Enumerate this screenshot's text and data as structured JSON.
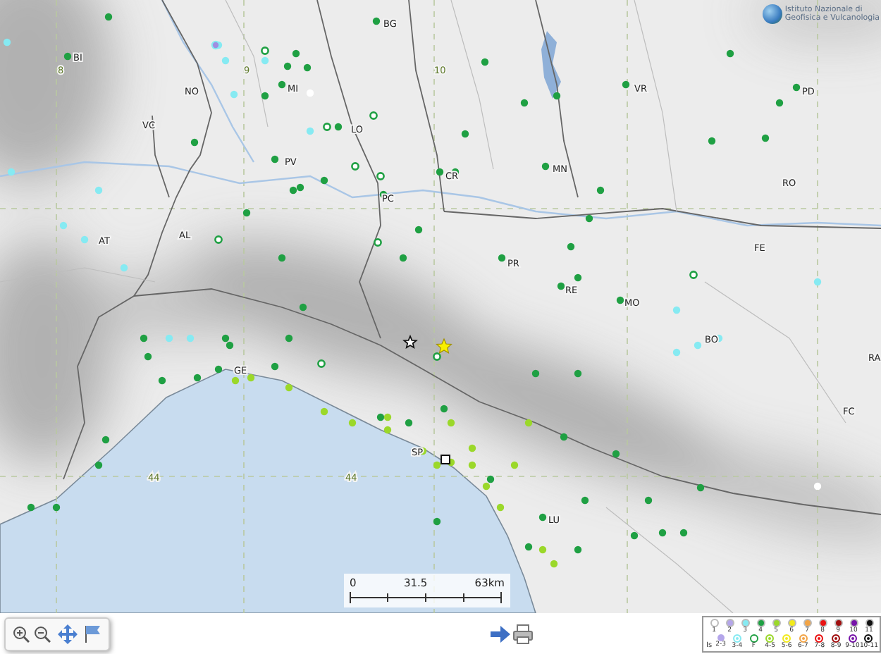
{
  "logo": {
    "lines": [
      "Istituto Nazionale di",
      "Geofisica e Vulcanologia"
    ]
  },
  "map": {
    "place_labels": [
      "BG",
      "BI",
      "NO",
      "MI",
      "VC",
      "LO",
      "PV",
      "CR",
      "PC",
      "MN",
      "VR",
      "PD",
      "RO",
      "FE",
      "PR",
      "RE",
      "MO",
      "BO",
      "RA",
      "FC",
      "GE",
      "SP",
      "LU",
      "AL",
      "AT"
    ],
    "grid_labels": [
      "8",
      "9",
      "10",
      "44",
      "44"
    ]
  },
  "scale_bar": {
    "labels": [
      "0",
      "31.5",
      "63km"
    ]
  },
  "legend": {
    "row_1": [
      {
        "label": "1",
        "color": "#ffffff"
      },
      {
        "label": "2",
        "color": "#b4a6ea"
      },
      {
        "label": "3",
        "color": "#86eaf2"
      },
      {
        "label": "4",
        "color": "#1fa043"
      },
      {
        "label": "5",
        "color": "#9bd82a"
      },
      {
        "label": "6",
        "color": "#f2ea1c"
      },
      {
        "label": "7",
        "color": "#f2a446"
      },
      {
        "label": "8",
        "color": "#ea1414"
      },
      {
        "label": "9",
        "color": "#a01010"
      },
      {
        "label": "10",
        "color": "#7614a8"
      },
      {
        "label": "11",
        "color": "#111111"
      }
    ],
    "row_2_title": "Is",
    "row_2": [
      {
        "label": "2-3",
        "color": "#b4a6ea",
        "kind": "dot"
      },
      {
        "label": "3-4",
        "color": "#86eaf2",
        "kind": "ring_dot"
      },
      {
        "label": "F",
        "color": "#1fa043",
        "kind": "ring"
      },
      {
        "label": "4-5",
        "color": "#9bd82a",
        "kind": "ring_dot"
      },
      {
        "label": "5-6",
        "color": "#f2ea1c",
        "kind": "ring_dot"
      },
      {
        "label": "6-7",
        "color": "#f2a446",
        "kind": "ring_dot"
      },
      {
        "label": "7-8",
        "color": "#ea1414",
        "kind": "ring_dot"
      },
      {
        "label": "8-9",
        "color": "#a01010",
        "kind": "ring_dot"
      },
      {
        "label": "9-10",
        "color": "#7614a8",
        "kind": "ring_dot"
      },
      {
        "label": "10-11",
        "color": "#111111",
        "kind": "ring_dot"
      }
    ]
  }
}
